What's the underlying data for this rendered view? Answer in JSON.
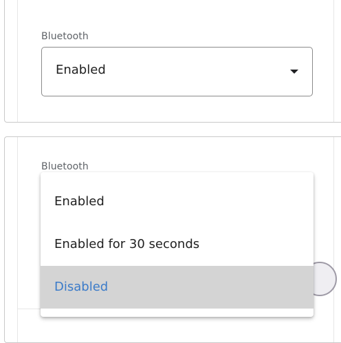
{
  "top_field": {
    "label": "Bluetooth",
    "value": "Enabled",
    "caret_icon": "caret-down-icon"
  },
  "bottom_field": {
    "label": "Bluetooth"
  },
  "dropdown": {
    "options": [
      {
        "label": "Enabled"
      },
      {
        "label": "Enabled for 30 seconds"
      },
      {
        "label": "Disabled"
      }
    ],
    "selected_index": 2,
    "selected_color": "#3b7bc9",
    "selected_background": "#d4d4d4"
  }
}
